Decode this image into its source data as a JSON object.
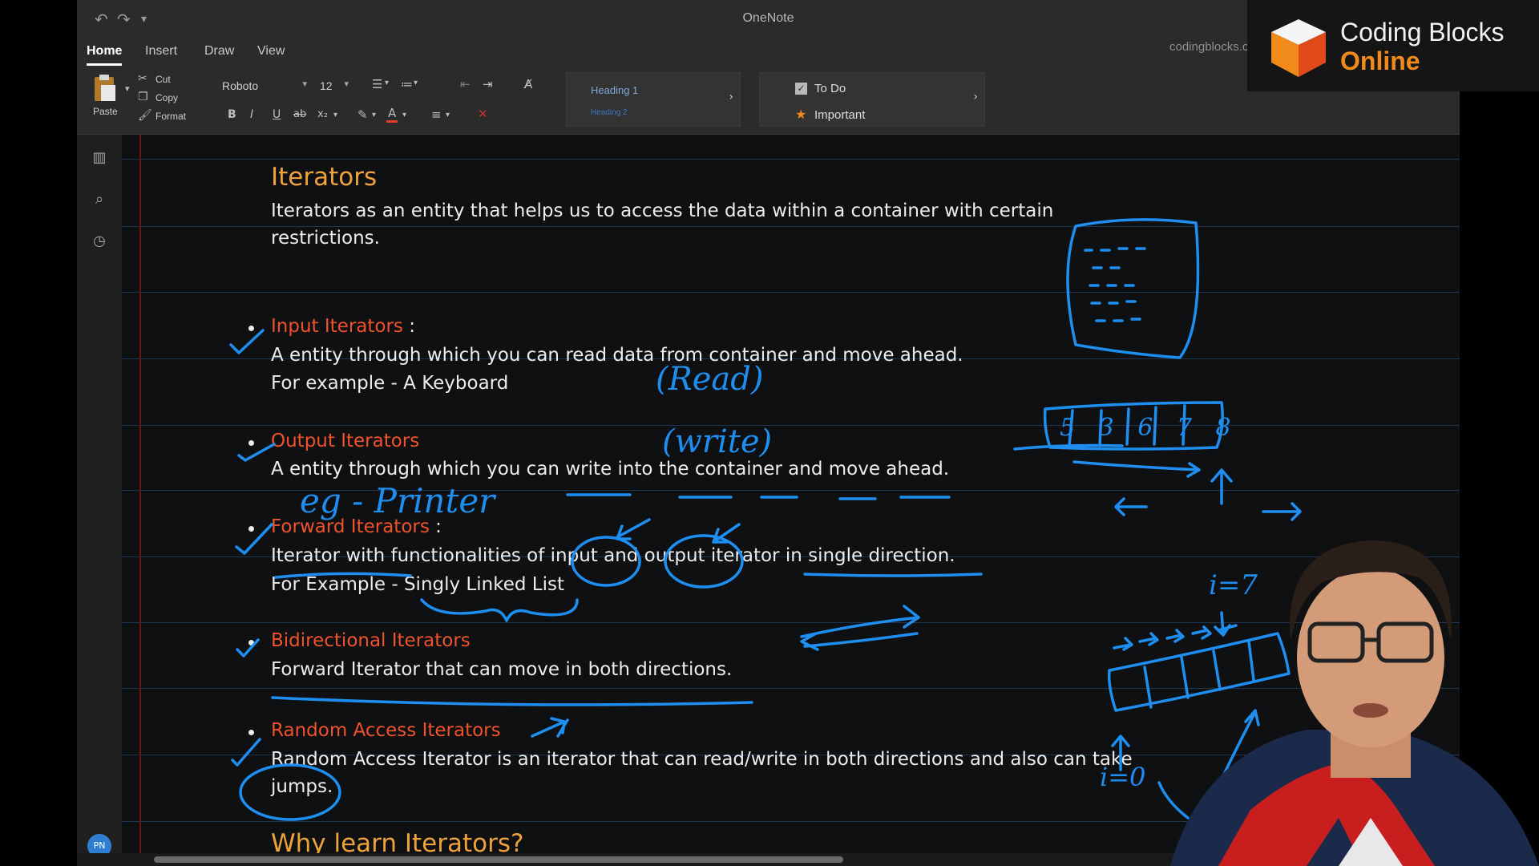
{
  "window": {
    "title": "OneNote",
    "qa_icons": [
      "undo-icon",
      "redo-icon",
      "customize-icon"
    ]
  },
  "ribbon": {
    "tabs": [
      "Home",
      "Insert",
      "Draw",
      "View"
    ],
    "active_tab": "Home",
    "clipboard": {
      "paste": "Paste",
      "cut": "Cut",
      "copy": "Copy",
      "format": "Format"
    },
    "font": {
      "family": "Roboto",
      "size": "12"
    },
    "styles": {
      "heading1": "Heading 1",
      "heading2": "Heading 2"
    },
    "tags": {
      "todo": "To Do",
      "important": "Important"
    }
  },
  "rail": {
    "avatar": "PN"
  },
  "note": {
    "title": "Iterators",
    "intro_line1": "Iterators as an entity that helps us to access the data within a container with certain",
    "intro_line2": "restrictions.",
    "items": [
      {
        "name": "Input Iterators",
        "suffix": " :",
        "line1": "A entity through which you can read data from container and move ahead.",
        "line2": "For example - A Keyboard"
      },
      {
        "name": "Output  Iterators",
        "suffix": "",
        "line1": "A entity through which you can write into the container and move ahead.",
        "line2": ""
      },
      {
        "name": "Forward Iterators",
        "suffix": " :",
        "line1": "Iterator with functionalities of input and output iterator in single direction.",
        "line2": "For Example - Singly Linked List"
      },
      {
        "name": "Bidirectional  Iterators",
        "suffix": "",
        "line1": "Forward Iterator that can move in both directions.",
        "line2": ""
      },
      {
        "name": "Random Access  Iterators",
        "suffix": "",
        "line1": "Random Access Iterator is an iterator that can read/write in both directions and also can take",
        "line2": "jumps."
      }
    ],
    "next_heading": "Why learn Iterators?"
  },
  "ink": {
    "read": "(Read)",
    "write": "(write)",
    "printer": "eg - Printer",
    "array_cells": "5 3 6 7 8",
    "i7": "i=7",
    "i0": "i=0"
  },
  "brand": {
    "name": "Coding Blocks",
    "sub": "Online",
    "watermark": "codingblocks.com"
  },
  "colors": {
    "heading": "#f0a23a",
    "iterator_name": "#f0522a",
    "ink": "#1e8ef0",
    "page_bg": "#0e1012"
  }
}
